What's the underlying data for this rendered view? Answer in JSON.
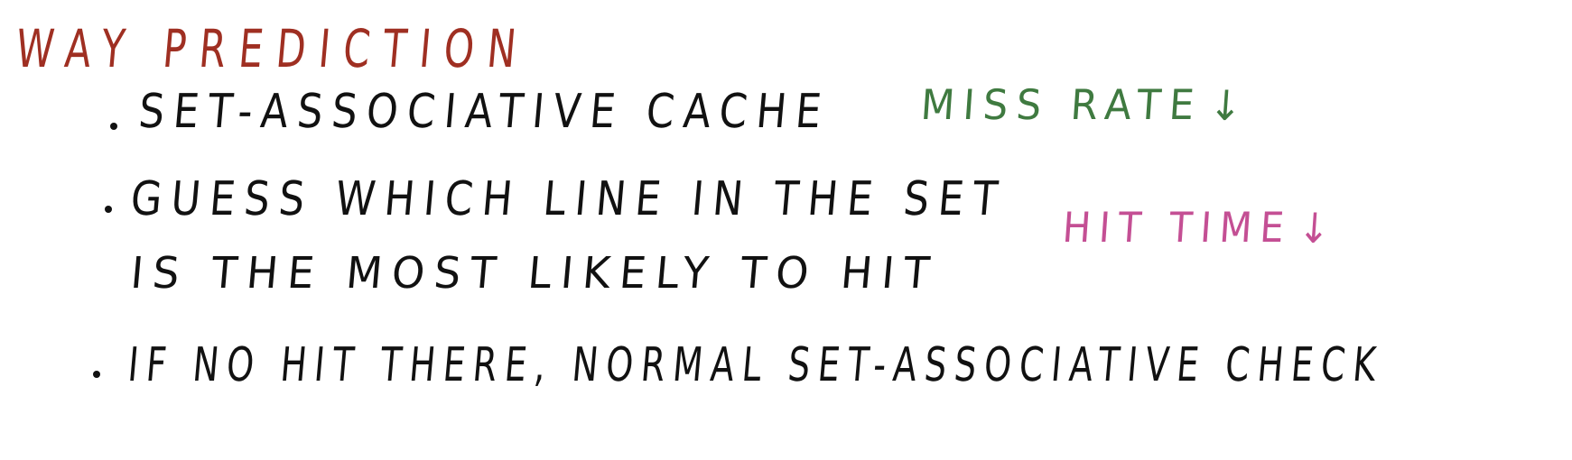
{
  "title": {
    "text": "WAY PREDICTION",
    "color": "#9f2f22"
  },
  "bullets": [
    {
      "text": "SET-ASSOCIATIVE CACHE",
      "color": "#111111"
    },
    {
      "line1": "GUESS WHICH LINE IN THE SET",
      "line2": "IS THE MOST LIKELY TO HIT",
      "color": "#111111"
    },
    {
      "text": "IF NO HIT THERE, NORMAL SET-ASSOCIATIVE CHECK",
      "color": "#111111"
    }
  ],
  "notes": [
    {
      "text": "MISS RATE",
      "arrow": "↓",
      "color": "#3f7a40"
    },
    {
      "text": "HIT TIME",
      "arrow": "↓",
      "color": "#c44f94"
    }
  ]
}
